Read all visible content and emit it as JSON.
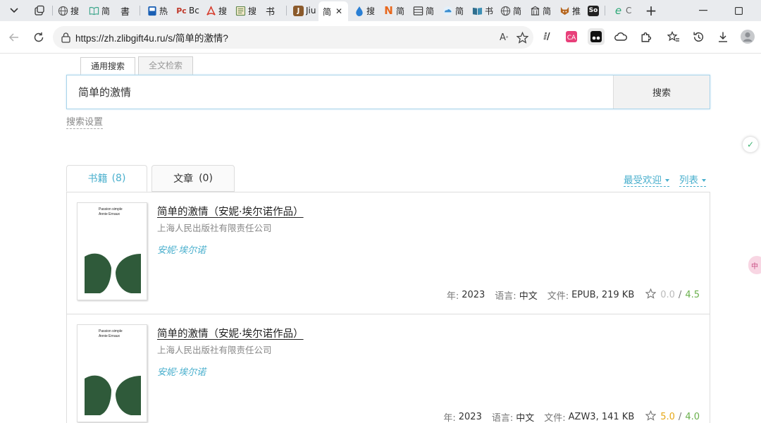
{
  "browser": {
    "tabs": [
      {
        "title": "",
        "icon": "globe-icon",
        "color": "#5f6b7a"
      },
      {
        "title": "搜",
        "icon": "globe-icon",
        "color": "#5f6b7a"
      },
      {
        "title": "简",
        "icon": "book-icon",
        "color": "#3aa58a"
      },
      {
        "title": "書",
        "icon": "text-icon",
        "color": "#222222"
      },
      {
        "title": "热",
        "icon": "notebook-icon",
        "color": "#1a5fb4"
      },
      {
        "title": "Bc",
        "icon": "pdf-icon",
        "color": "#c0392b"
      },
      {
        "title": "搜",
        "icon": "acrobat-icon",
        "color": "#d63a2a"
      },
      {
        "title": "搜",
        "icon": "book-icon",
        "color": "#4a7a3a"
      },
      {
        "title": "",
        "icon": "text-icon",
        "color": "#222222"
      },
      {
        "title": "Jiu",
        "icon": "letter-icon",
        "color": "#8b5a2b"
      },
      {
        "title": "简",
        "icon": "",
        "color": "#ffffff"
      },
      {
        "title": "搜",
        "icon": "drop-icon",
        "color": "#2a7fd4"
      },
      {
        "title": "简",
        "icon": "letter-icon",
        "color": "#e8671c"
      },
      {
        "title": "简",
        "icon": "grid-icon",
        "color": "#444444"
      },
      {
        "title": "简",
        "icon": "cloud-icon",
        "color": "#3b8ed0"
      },
      {
        "title": "书",
        "icon": "book-icon",
        "color": "#2f6f8f"
      },
      {
        "title": "简",
        "icon": "globe-icon",
        "color": "#5f6b7a"
      },
      {
        "title": "简",
        "icon": "building-icon",
        "color": "#444444"
      },
      {
        "title": "推",
        "icon": "fox-icon",
        "color": "#b5651d"
      },
      {
        "title": "",
        "icon": "letter-icon",
        "color": "#222222"
      },
      {
        "title": "C",
        "icon": "edge-icon",
        "color": "#2aa876"
      }
    ],
    "tab_favicon_text": {
      "book": "書",
      "so": "So",
      "j": "J",
      "n": "N",
      "c": "C",
      "text": "书"
    },
    "active_tab_index": 10,
    "url": "https://zh.zlibgift4u.ru/s/简单的激情?"
  },
  "search": {
    "tabs": [
      "通用搜索",
      "全文检索"
    ],
    "query": "简单的激情",
    "button": "搜索",
    "settings_link": "搜索设置"
  },
  "results": {
    "tabs": [
      {
        "label": "书籍",
        "count": "(8)"
      },
      {
        "label": "文章",
        "count": "(0)"
      }
    ],
    "sort": [
      "最受欢迎",
      "列表"
    ],
    "labels": {
      "year": "年:",
      "language": "语言:",
      "file": "文件:"
    },
    "books": [
      {
        "title": "简单的激情（安妮·埃尔诺作品）",
        "publisher": "上海人民出版社有限责任公司",
        "author": "安妮·埃尔诺",
        "year": "2023",
        "language": "中文",
        "file": "EPUB, 219 KB",
        "rating_a": "0.0",
        "rating_b": "4.5",
        "rating_a_color": "#bbbbbb",
        "cover": {
          "title": "Passion simple",
          "author": "Annie Ernaux"
        }
      },
      {
        "title": "简单的激情（安妮·埃尔诺作品）",
        "publisher": "上海人民出版社有限责任公司",
        "author": "安妮·埃尔诺",
        "year": "2023",
        "language": "中文",
        "file": "AZW3, 141 KB",
        "rating_a": "5.0",
        "rating_b": "4.0",
        "rating_a_color": "#e6a817",
        "cover": {
          "title": "Passion simple",
          "author": "Annie Ernaux"
        }
      }
    ]
  },
  "colors": {
    "accent": "#49afcd",
    "rating_green": "#6ab04c",
    "cover_green": "#2f5a3a"
  }
}
